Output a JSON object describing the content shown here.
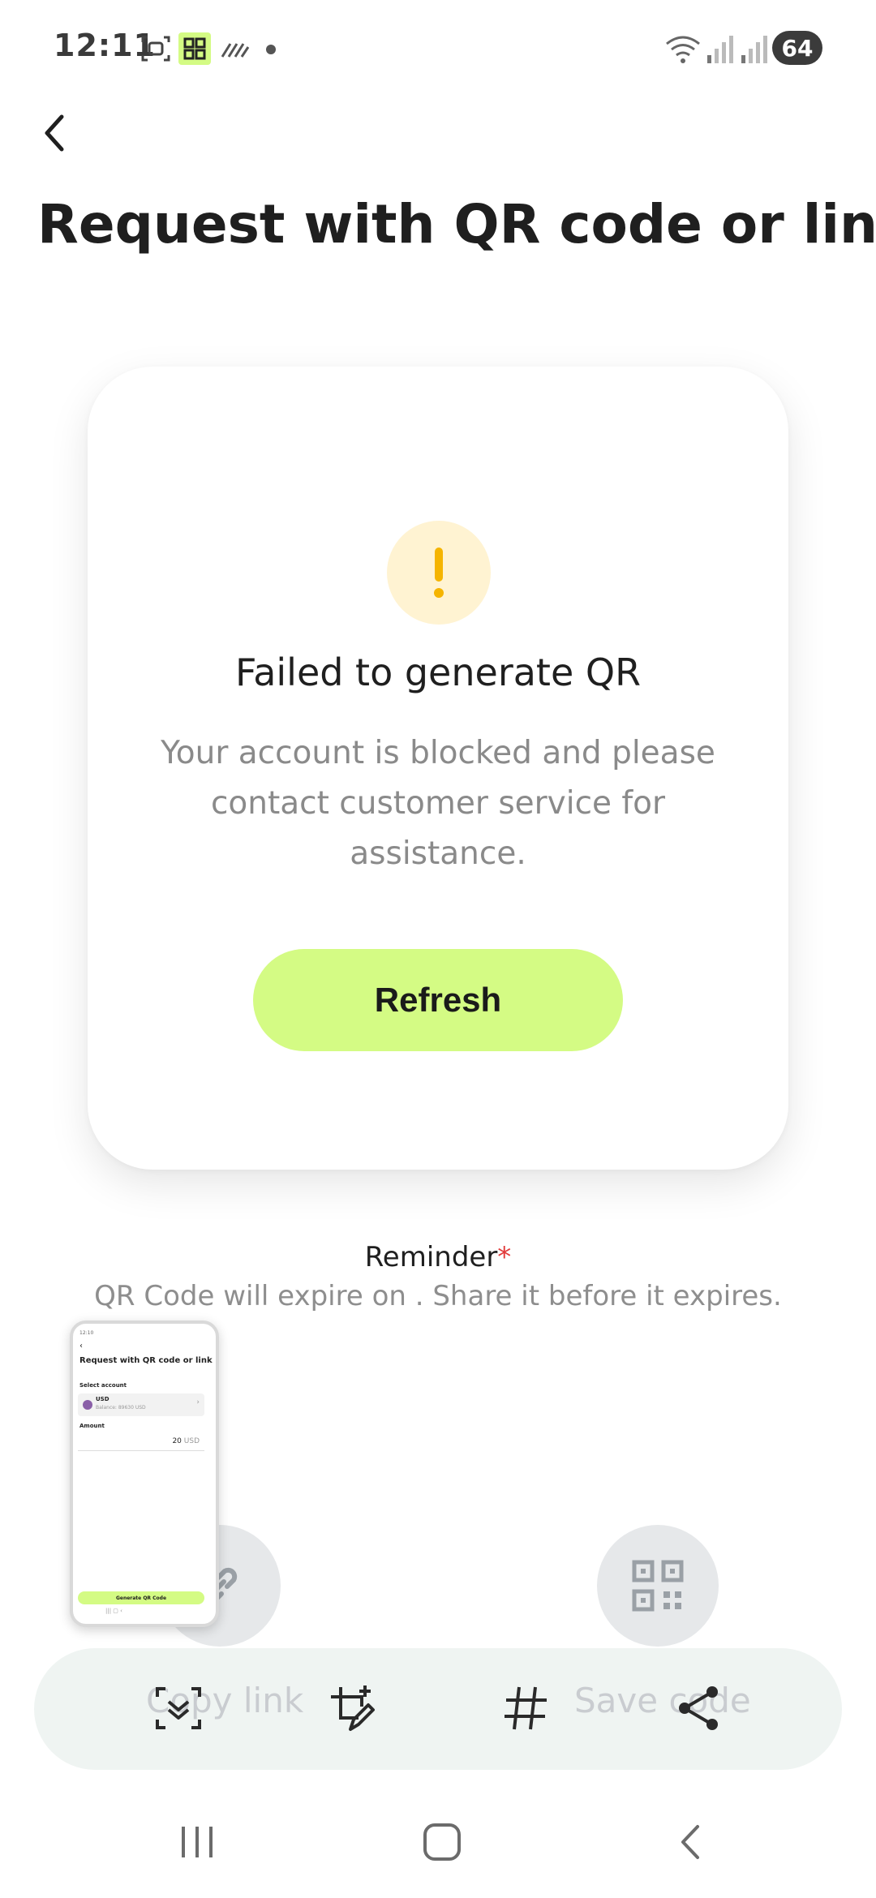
{
  "status_bar": {
    "time": "12:11",
    "battery": "64",
    "icons": [
      "screenshot-icon",
      "app-grid-icon",
      "stripes-icon",
      "dot-icon",
      "wifi-icon",
      "signal-icon",
      "signal-icon-2"
    ]
  },
  "header": {
    "back_icon": "chevron-left-icon",
    "title": "Request with QR code or link"
  },
  "card": {
    "icon": "exclamation-icon",
    "icon_color": "#f5b400",
    "icon_bg": "#fff3d2",
    "title": "Failed to generate QR",
    "message": "Your account is blocked and please contact customer service for assistance.",
    "button_label": "Refresh",
    "button_color": "#d4fb84"
  },
  "reminder": {
    "label": "Reminder",
    "required_mark": "*",
    "note": "QR Code will expire on . Share it before it expires."
  },
  "actions": {
    "copy_link_label": "Copy link",
    "save_code_label": "Save code"
  },
  "screenshot_toolbar": {
    "icons": [
      "scroll-capture-icon",
      "edit-crop-icon",
      "hashtag-icon",
      "share-icon"
    ]
  },
  "thumbnail": {
    "title": "Request with QR code or link",
    "select_account_label": "Select account",
    "account_currency": "USD",
    "account_balance": "Balance: 89630 USD",
    "amount_label": "Amount",
    "amount_value": "20",
    "amount_currency": "USD",
    "button_label": "Generate QR Code"
  },
  "nav_bar": {
    "icons": [
      "recents-icon",
      "home-icon",
      "back-icon"
    ]
  }
}
